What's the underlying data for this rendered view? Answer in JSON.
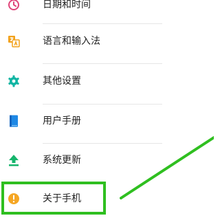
{
  "settings": {
    "items": [
      {
        "label": "日期和时间",
        "icon": "clock-icon"
      },
      {
        "label": "语言和输入法",
        "icon": "language-icon"
      },
      {
        "label": "其他设置",
        "icon": "gear-icon"
      },
      {
        "label": "用户手册",
        "icon": "book-icon"
      },
      {
        "label": "系统更新",
        "icon": "upload-icon"
      },
      {
        "label": "关于手机",
        "icon": "info-icon"
      }
    ]
  },
  "colors": {
    "highlight": "#2fbf20",
    "clock": "#e0457a",
    "language": "#f2a11a",
    "gear": "#11b5a3",
    "book": "#1e88e5",
    "upload": "#16b56c",
    "info": "#f5a623"
  }
}
